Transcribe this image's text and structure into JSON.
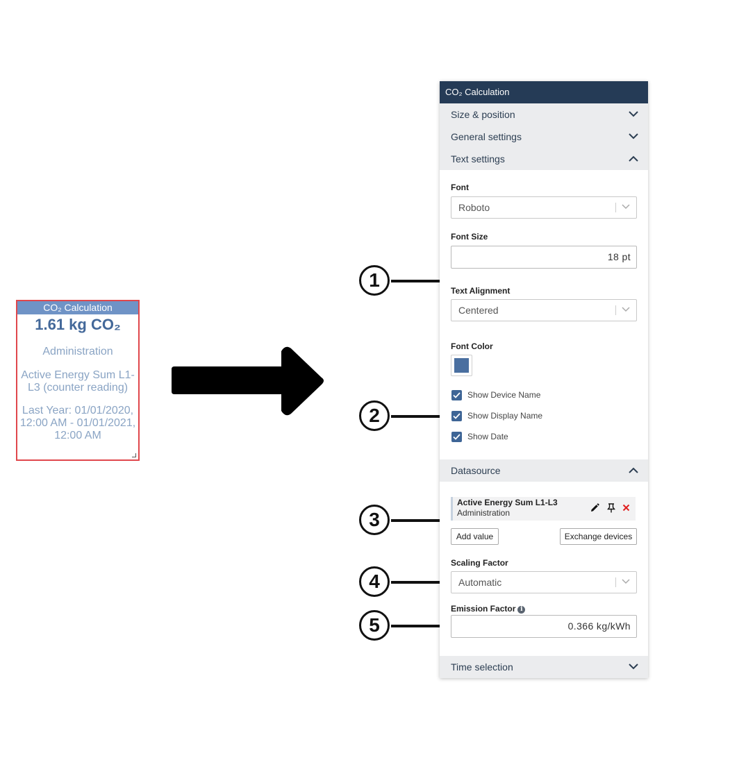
{
  "widget": {
    "title": "CO₂ Calculation",
    "value": "1.61 kg CO₂",
    "device_name": "Administration",
    "display_name": "Active Energy Sum L1-L3 (counter reading)",
    "date": "Last Year: 01/01/2020, 12:00 AM - 01/01/2021, 12:00 AM"
  },
  "callouts": [
    "1",
    "2",
    "3",
    "4",
    "5"
  ],
  "panel": {
    "title": "CO₂ Calculation",
    "sections": {
      "size_position": "Size & position",
      "general_settings": "General settings",
      "text_settings": "Text settings",
      "datasource": "Datasource",
      "time_selection": "Time selection"
    },
    "text_settings": {
      "font_label": "Font",
      "font_value": "Roboto",
      "font_size_label": "Font Size",
      "font_size_value": "18 pt",
      "alignment_label": "Text Alignment",
      "alignment_value": "Centered",
      "font_color_label": "Font Color",
      "font_color": "#4a6fa0",
      "checkboxes": [
        {
          "label": "Show Device Name",
          "checked": true
        },
        {
          "label": "Show Display Name",
          "checked": true
        },
        {
          "label": "Show Date",
          "checked": true
        }
      ]
    },
    "datasource": {
      "item_title": "Active Energy Sum L1-L3",
      "item_subtitle": "Administration",
      "item_icons": [
        "pencil-icon",
        "pin-icon",
        "remove-icon"
      ],
      "add_value_label": "Add value",
      "exchange_devices_label": "Exchange devices",
      "scaling_factor_label": "Scaling Factor",
      "scaling_factor_value": "Automatic",
      "emission_factor_label": "Emission Factor",
      "emission_factor_value": "0.366 kg/kWh"
    }
  }
}
